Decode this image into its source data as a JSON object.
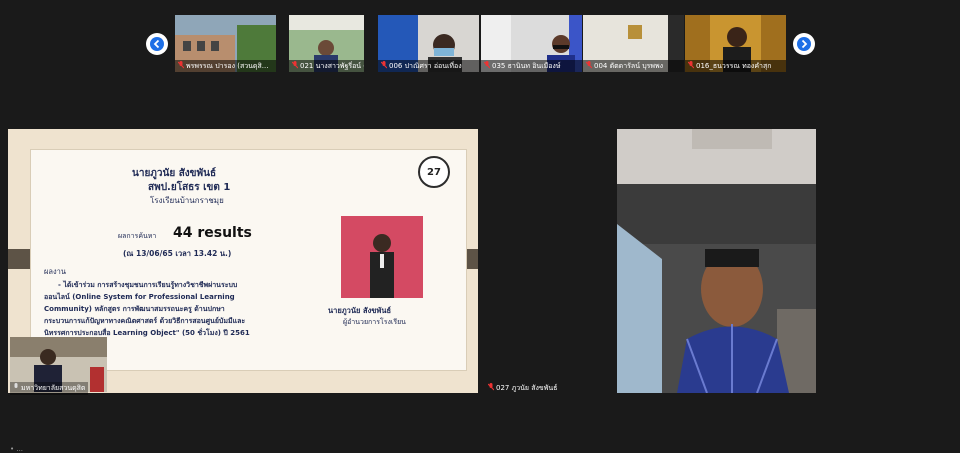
{
  "participants": [
    {
      "name": "พรพรรณ ปารอง (สวนดุสิ..."
    },
    {
      "name": "021 นางสาวพัฐรี่อน์ คัส..."
    },
    {
      "name": "006 ปาณิศรา อ่อนเที่อง"
    },
    {
      "name": "035 ธานินท อินเมืองษ์"
    },
    {
      "name": "004 ตัตดารัลน์ บุรพพง"
    },
    {
      "name": "016_ธนวรรณ ทองคำสุก"
    }
  ],
  "shared_screen": {
    "presenter_name": "มหาวิทยาลัยสวนดุสิต",
    "slide_number": "27",
    "title_name": "นายภูวนัย    สังขพันธ์",
    "title_office": "สพป.ยโสธร เขต 1",
    "title_school": "โรงเรียนบ้านกราชมุย",
    "result_label": "ผลการค้นหา",
    "result_value": "44 results",
    "date_line": "(ณ 13/06/65  เวลา 13.42 น.)",
    "works_label": "ผลงาน",
    "works_line1": "- ได้เข้าร่วม การสร้างชุมชนการเรียนรู้ทางวิชาชีพผ่านระบบ",
    "works_line2": "ออนไลน์ (Online System for Professional Learning",
    "works_line3": "Community)  หลักสูตร การพัฒนาสมรรถนะครู ด้านปกษา",
    "works_line4": "กระบวนการแก้ปัญหาทางคณิตศาสตร์ ด้วยวิธีการสอนศูนย์บัมมีและ",
    "works_line5": "นิทรรศการประกอบสื่อ Learning Object\" (50 ชั่วโมง) ปี 2561",
    "photo_name": "นายภูวนัย    สังขพันธ์",
    "photo_role": "ผู้อำนวยการโรงเรียน"
  },
  "speaker": {
    "name": "027 ภูวนัย สังขพันธ์"
  },
  "footer_text": "• ..."
}
